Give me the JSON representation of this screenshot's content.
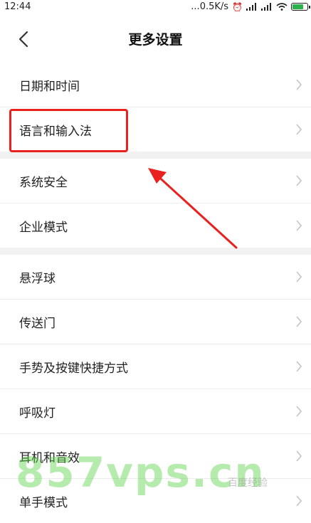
{
  "status": {
    "time": "12:44",
    "network_speed": "...0.5K/s"
  },
  "header": {
    "title": "更多设置"
  },
  "sections": [
    {
      "items": [
        {
          "label": "日期和时间"
        },
        {
          "label": "语言和输入法"
        }
      ]
    },
    {
      "items": [
        {
          "label": "系统安全"
        },
        {
          "label": "企业模式"
        }
      ]
    },
    {
      "items": [
        {
          "label": "悬浮球"
        },
        {
          "label": "传送门"
        },
        {
          "label": "手势及按键快捷方式"
        },
        {
          "label": "呼吸灯"
        },
        {
          "label": "耳机和音效"
        },
        {
          "label": "单手模式"
        }
      ]
    }
  ],
  "annotation": {
    "highlight_color": "#e8221f"
  },
  "watermark": {
    "text": "857vps.cn",
    "small": "百度经验"
  }
}
